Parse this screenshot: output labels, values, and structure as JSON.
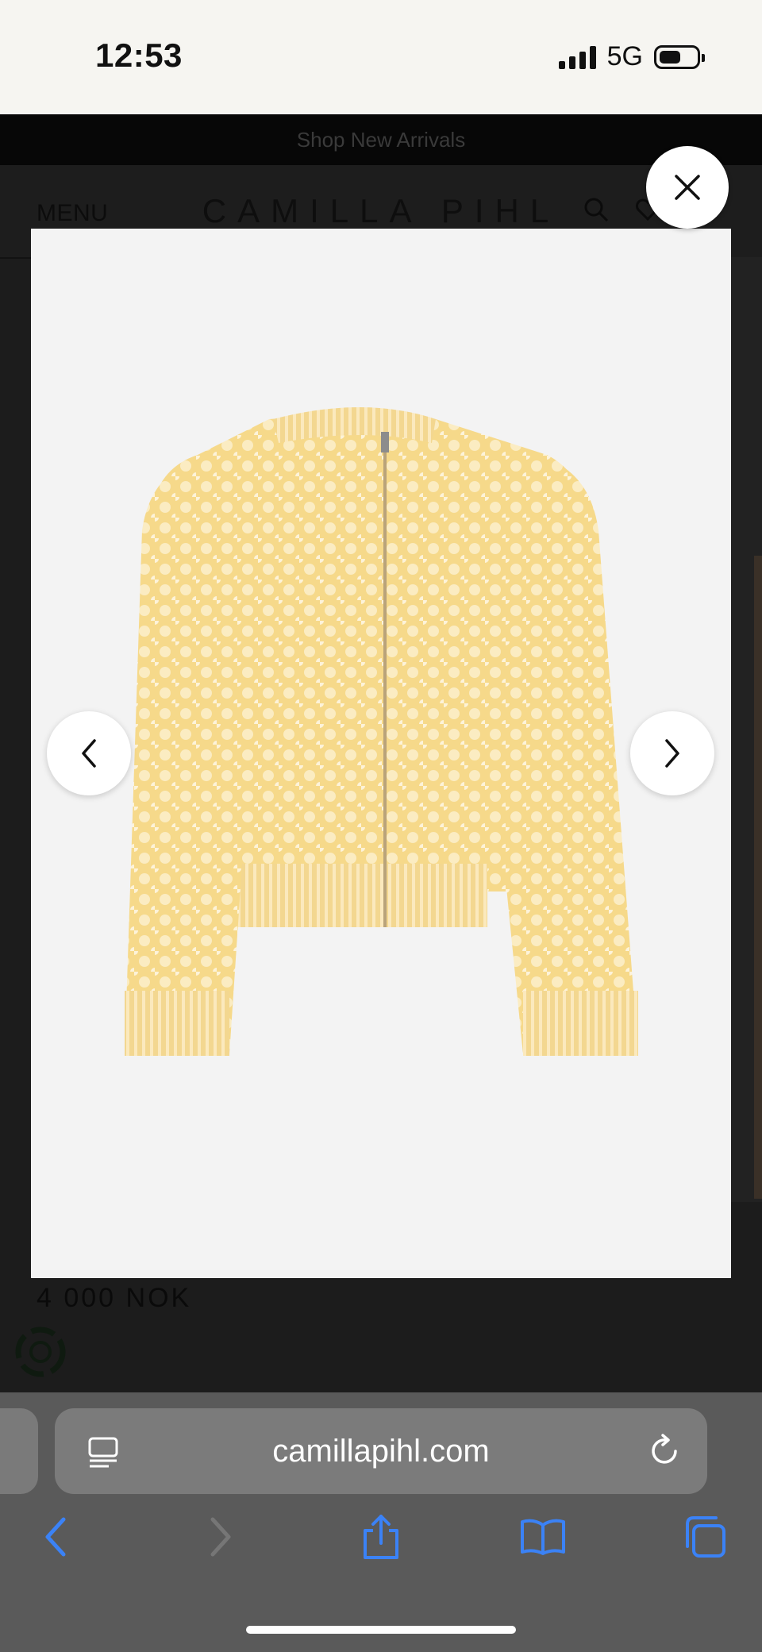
{
  "status_bar": {
    "time": "12:53",
    "network": "5G"
  },
  "site": {
    "promo": "Shop New Arrivals",
    "menu_label": "MENU",
    "brand": "CAMILLA PIHL",
    "price": "4 000 NOK"
  },
  "browser": {
    "url": "camillapihl.com",
    "accent_color": "#3b82f6"
  },
  "icons": {
    "close": "close-icon",
    "prev": "chevron-left-icon",
    "next": "chevron-right-icon",
    "search": "search-icon",
    "wishlist": "heart-icon",
    "reader": "reader-icon",
    "reload": "reload-icon",
    "back": "back-icon",
    "forward": "forward-icon",
    "share": "share-icon",
    "bookmarks": "bookmarks-icon",
    "tabs": "tabs-icon"
  }
}
